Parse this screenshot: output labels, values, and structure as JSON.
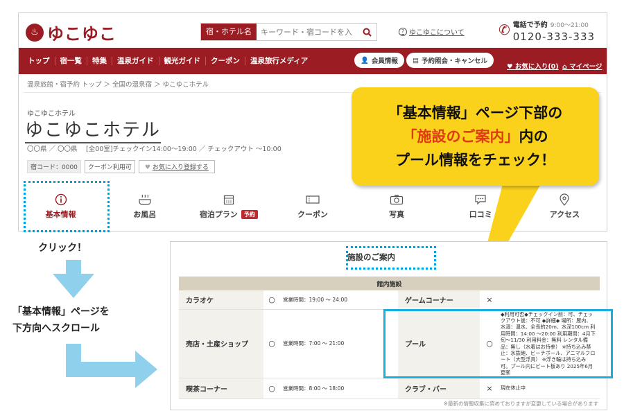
{
  "site": {
    "logo": "ゆこゆこ",
    "search_type": "宿・ホテル名",
    "search_placeholder": "キーワード・宿コードを入力",
    "about": "ゆこゆこについて",
    "phone_label": "電話で予約",
    "phone_hours": "9:00〜21:00",
    "phone_number": "0120-333-333",
    "nav": [
      "トップ",
      "宿一覧",
      "特集",
      "温泉ガイド",
      "観光ガイド",
      "クーポン",
      "温泉旅行メディア"
    ],
    "member_info": "会員情報",
    "reservation": "予約照会・キャンセル",
    "favorites": "お気に入り(0)",
    "mypage": "マイページ",
    "breadcrumb": "温泉旅館・宿予約 トップ ＞ 全国の温泉宿 ＞ ゆこゆこホテル",
    "hotel_kana": "ゆこゆこホテル",
    "hotel_name": "ゆこゆこホテル",
    "hotel_meta": "〇〇県 ／ 〇〇県　 [全00室]チェックイン14:00〜19:00 ／ チェックアウト 〜10:00",
    "hotel_code": "宿コード：0000",
    "coupon_tag": "クーポン利用可",
    "fav_tag": "お気に入り登録する",
    "tabs": [
      {
        "label": "基本情報",
        "icon": "info-icon"
      },
      {
        "label": "お風呂",
        "icon": "bath-icon"
      },
      {
        "label": "宿泊プラン",
        "icon": "calendar-icon",
        "badge": "予約"
      },
      {
        "label": "クーポン",
        "icon": "coupon-icon"
      },
      {
        "label": "写真",
        "icon": "camera-icon"
      },
      {
        "label": "口コミ",
        "icon": "review-icon"
      },
      {
        "label": "アクセス",
        "icon": "location-icon"
      }
    ]
  },
  "annotations": {
    "click": "クリック！",
    "scroll_line1": "「基本情報」ページを",
    "scroll_line2": "下方向へスクロール",
    "callout_line1": "「基本情報」ページ下部の",
    "callout_red": "「施設のご案内」",
    "callout_line2_tail": "内の",
    "callout_line3": "プール情報をチェック！"
  },
  "facility": {
    "title": "施設のご案内",
    "header": "館内施設",
    "rows": [
      {
        "name": "カラオケ",
        "mark": "○",
        "detail": "営業時間：19:00 〜 24:00",
        "name2": "ゲームコーナー",
        "mark2": "×",
        "detail2": ""
      },
      {
        "name": "売店・土産ショップ",
        "mark": "○",
        "detail": "営業時間：7:00 〜 21:00",
        "name2": "プール",
        "mark2": "○",
        "detail2": "◆利用可否◆チェックイン前：可、チェックアウト後：不可 ◆詳細◆ 場所：屋内、水温：温水、全長約20m、水深100cm 利用時間：14:00 〜20:00 利用期間：4月下旬〜11/30 利用料金：無料 レンタル備品：無し（水着はお持参） ※持ち込み禁止：水鉄砲、ビーチボール、アニマルフロート（大型浮具） ※浮き輪は持ち込み可。プール内にビート板あり 2025年6月更新"
      },
      {
        "name": "喫茶コーナー",
        "mark": "○",
        "detail": "営業時間：8:00 〜 18:00",
        "name2": "クラブ・バー",
        "mark2": "×",
        "detail2": "現在休止中"
      }
    ],
    "note": "※最新の情報収集に努めておりますが変更している場合があります"
  },
  "colors": {
    "brand": "#9b1c22",
    "callout": "#fbd21b",
    "highlight": "#19aede"
  }
}
